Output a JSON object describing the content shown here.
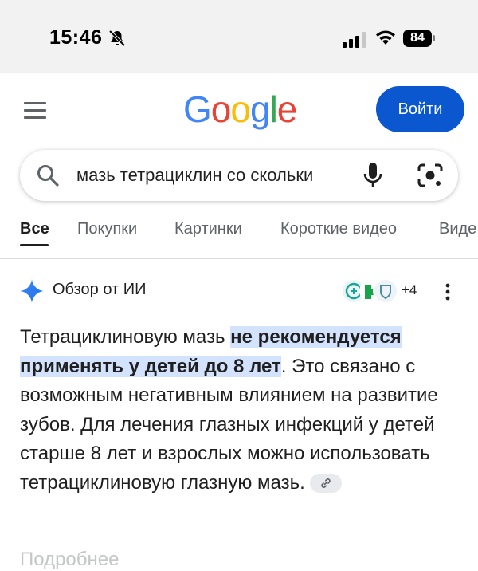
{
  "status_bar": {
    "time": "15:46",
    "battery": "84"
  },
  "header": {
    "logo_letters": [
      "G",
      "o",
      "o",
      "g",
      "l",
      "e"
    ],
    "logo_colors": [
      "#4285f4",
      "#ea4335",
      "#fbbc05",
      "#4285f4",
      "#34a853",
      "#ea4335"
    ],
    "signin_label": "Войти"
  },
  "search": {
    "query": "мазь тетрациклин со скольки"
  },
  "tabs": [
    {
      "label": "Все",
      "active": true
    },
    {
      "label": "Покупки",
      "active": false
    },
    {
      "label": "Картинки",
      "active": false
    },
    {
      "label": "Короткие видео",
      "active": false
    },
    {
      "label": "Виде",
      "active": false
    }
  ],
  "ai_overview": {
    "title": "Обзор от ИИ",
    "sources_more": "+4",
    "text_before": "Тетрациклиновую мазь ",
    "text_highlight": "не рекомендуется применять у детей до 8 лет",
    "text_after": ". Это связано с возможным негативным влиянием на развитие зубов. Для лечения глазных инфекций у детей старше 8 лет и взрослых можно использовать тетрациклиновую глазную мазь."
  },
  "more_heading": "Подробнее"
}
